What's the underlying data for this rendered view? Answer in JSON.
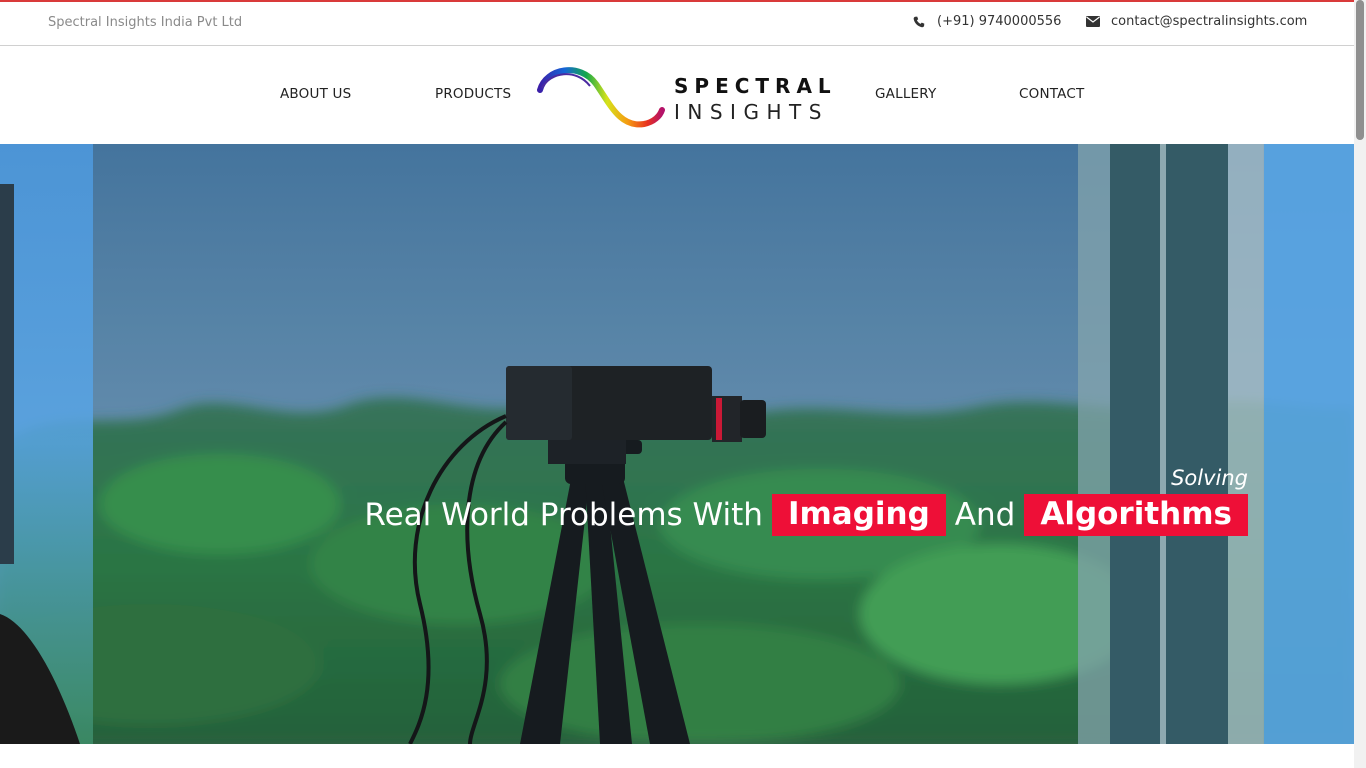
{
  "topbar": {
    "company": "Spectral Insights India Pvt Ltd",
    "phone": "(+91) 9740000556",
    "email": "contact@spectralinsights.com",
    "phone_icon": "phone-icon",
    "email_icon": "envelope-icon"
  },
  "nav": {
    "about": "ABOUT US",
    "products": "PRODUCTS",
    "gallery": "GALLERY",
    "contact": "CONTACT"
  },
  "logo": {
    "line1": "SPECTRAL",
    "line2": "INSIGHTS"
  },
  "hero": {
    "kicker": "Solving",
    "text_1": "Real World Problems With",
    "highlight_1": "Imaging",
    "text_2": "And",
    "highlight_2": "Algorithms",
    "highlight_color": "#ee0f37"
  }
}
